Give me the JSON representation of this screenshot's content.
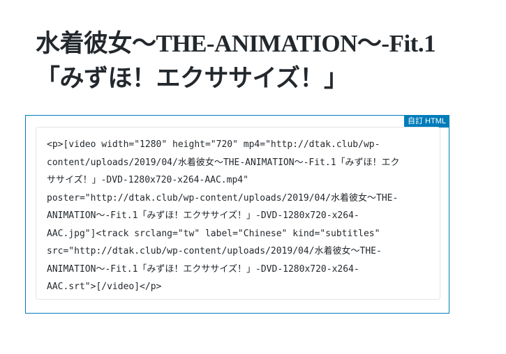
{
  "post": {
    "title": "水着彼女～THE-ANIMATION～-Fit.1「みずほ！エクササイズ！」"
  },
  "block": {
    "badge": "自訂 HTML",
    "code_lines": [
      "<p>[video width=\"1280\" height=\"720\" mp4=\"http://dtak.club/wp-",
      "content/uploads/2019/04/水着彼女～THE-ANIMATION～-Fit.1「みずほ！エク",
      "ササイズ！」-DVD-1280x720-x264-AAC.mp4\"",
      "poster=\"http://dtak.club/wp-content/uploads/2019/04/水着彼女～THE-",
      "ANIMATION～-Fit.1「みずほ！エクササイズ！」-DVD-1280x720-x264-",
      "AAC.jpg\"]<track srclang=\"tw\" label=\"Chinese\" kind=\"subtitles\"",
      "src=\"http://dtak.club/wp-content/uploads/2019/04/水着彼女～THE-",
      "ANIMATION～-Fit.1「みずほ！エクササイズ！」-DVD-1280x720-x264-",
      "AAC.srt\">[/video]</p>"
    ]
  }
}
